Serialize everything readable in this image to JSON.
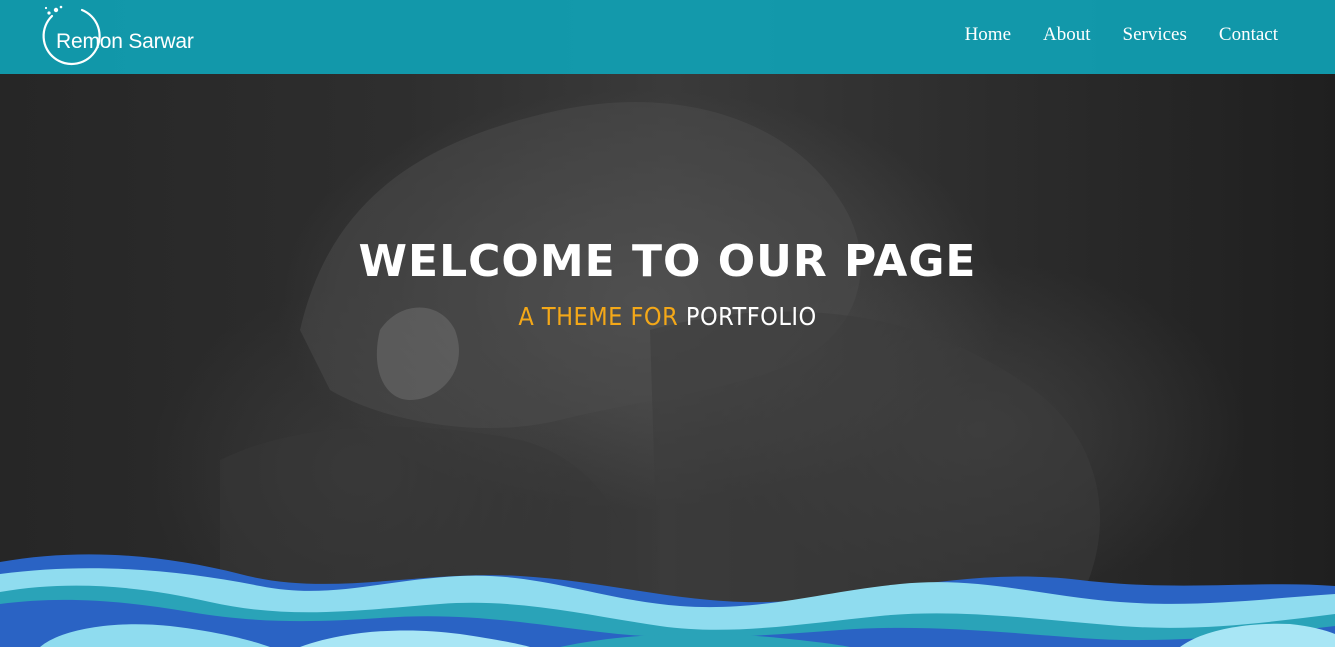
{
  "brand": {
    "name": "Remon Sarwar"
  },
  "nav": {
    "items": [
      {
        "label": "Home"
      },
      {
        "label": "About"
      },
      {
        "label": "Services"
      },
      {
        "label": "Contact"
      }
    ]
  },
  "hero": {
    "title": "WELCOME TO OUR PAGE",
    "subtitle_accent": "A THEME FOR",
    "subtitle_highlight": "PORTFOLIO",
    "background": "dark-grayscale-hands-photo"
  },
  "colors": {
    "navbar": "#10a0b4",
    "accent": "#f4a818",
    "wave_dark_blue": "#2a63c4",
    "wave_teal": "#2aa3b8",
    "wave_light": "#8fdcef"
  }
}
